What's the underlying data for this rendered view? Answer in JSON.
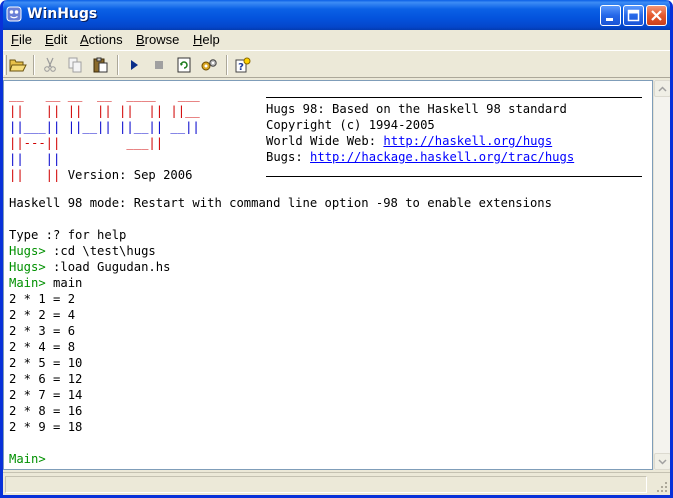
{
  "window": {
    "title": "WinHugs",
    "colors": {
      "titlebar": "#0453dd",
      "prompt": "#009000",
      "logo": "#d00000",
      "link": "#0000ff"
    }
  },
  "menu": [
    {
      "label": "File",
      "accel": "F"
    },
    {
      "label": "Edit",
      "accel": "E"
    },
    {
      "label": "Actions",
      "accel": "A"
    },
    {
      "label": "Browse",
      "accel": "B"
    },
    {
      "label": "Help",
      "accel": "H"
    }
  ],
  "toolbar": {
    "icons": [
      "open-folder-icon",
      "cut-icon",
      "copy-icon",
      "paste-icon",
      "run-icon",
      "stop-icon",
      "reload-icon",
      "options-icon",
      "help-icon"
    ]
  },
  "banner": {
    "logo_lines": [
      "__   __ __  __  ____   ___",
      "||   || ||  || ||  || ||__",
      "||___|| ||__|| ||__|| __||",
      "||---||         ___||",
      "||   ||",
      "||   || Version: Sep 2006"
    ],
    "info_line1": "Hugs 98: Based on the Haskell 98 standard",
    "info_line2": "Copyright (c) 1994-2005",
    "www_label": "World Wide Web: ",
    "www_link": "http://haskell.org/hugs",
    "bugs_label": "Bugs: ",
    "bugs_link": "http://hackage.haskell.org/trac/hugs"
  },
  "console": {
    "mode_line": "Haskell 98 mode: Restart with command line option -98 to enable extensions",
    "help_line": "Type :? for help",
    "commands": [
      {
        "prompt": "Hugs>",
        "text": " :cd \\test\\hugs"
      },
      {
        "prompt": "Hugs>",
        "text": " :load Gugudan.hs"
      },
      {
        "prompt": "Main>",
        "text": " main"
      }
    ],
    "output": [
      "2 * 1 = 2",
      "2 * 2 = 4",
      "2 * 3 = 6",
      "2 * 4 = 8",
      "2 * 5 = 10",
      "2 * 6 = 12",
      "2 * 7 = 14",
      "2 * 8 = 16",
      "2 * 9 = 18"
    ],
    "final_prompt": "Main>"
  }
}
